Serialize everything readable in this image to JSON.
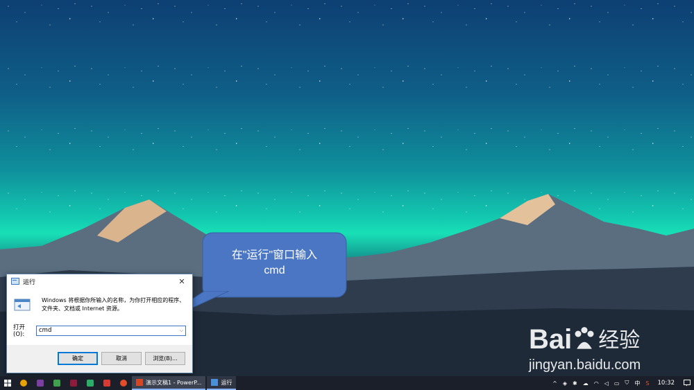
{
  "run_dialog": {
    "title": "运行",
    "description": "Windows 将根据你所输入的名称，为你打开相应的程序、文件夹、文档或 Internet 资源。",
    "open_label": "打开(O):",
    "open_value": "cmd",
    "ok_label": "确定",
    "cancel_label": "取消",
    "browse_label": "浏览(B)..."
  },
  "callout": {
    "line1": "在\"运行\"窗口输入",
    "line2": "cmd"
  },
  "watermark": {
    "brand": "Bai",
    "brand_suffix": "经验",
    "url": "jingyan.baidu.com"
  },
  "taskbar": {
    "windows": [
      {
        "label": "演示文稿1 - PowerP...",
        "icon": "powerpoint-icon",
        "color": "#d24726"
      },
      {
        "label": "运行",
        "icon": "run-icon",
        "color": "#4a90d9"
      }
    ],
    "tray": {
      "ime": "中",
      "time": "10:32"
    }
  },
  "colors": {
    "callout_fill": "#4a76c4",
    "taskbar": "#1b1f2a",
    "accent": "#0078d7"
  }
}
